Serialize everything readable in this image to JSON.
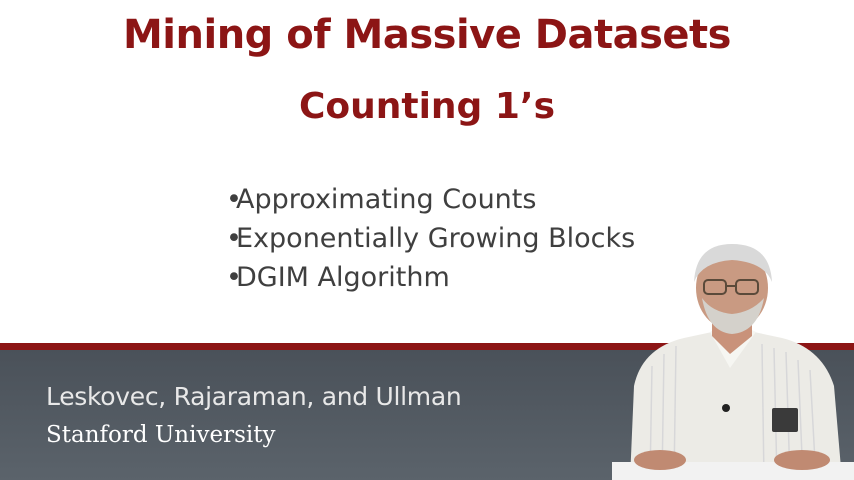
{
  "slide": {
    "title": "Mining of Massive Datasets",
    "subtitle": "Counting 1’s",
    "topics": [
      "Approximating Counts",
      "Exponentially Growing Blocks",
      "DGIM Algorithm"
    ],
    "bullet": "•"
  },
  "footer": {
    "authors": "Leskovec, Rajaraman, and Ullman",
    "university": "Stanford University"
  },
  "colors": {
    "accent": "#8c1515",
    "footer_bg": "#4a5159",
    "body_text": "#3f3f3f"
  }
}
